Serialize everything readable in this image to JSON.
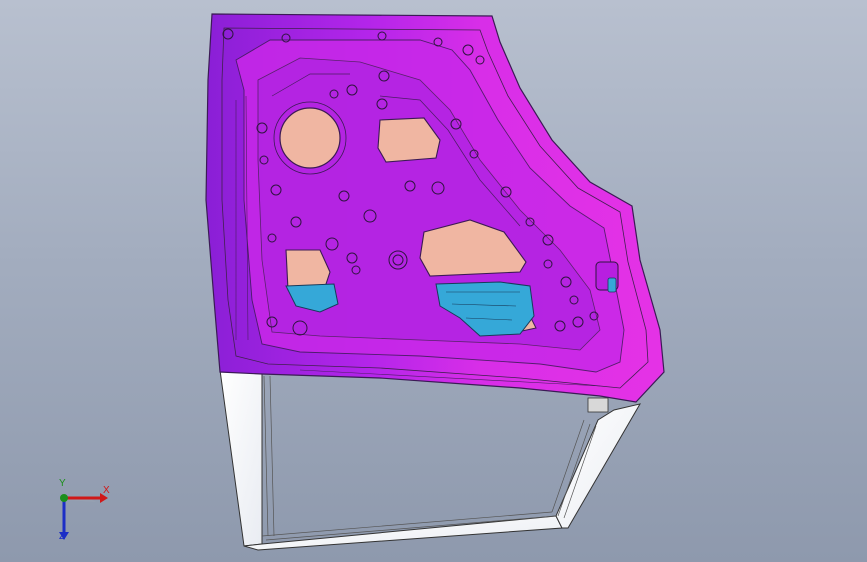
{
  "viewport": {
    "background_top": "#b8c0cf",
    "background_bottom": "#8e99ad"
  },
  "model": {
    "panel_color": "#d024e6",
    "panel_shade_color": "#9a1fd0",
    "edge_color": "#3b1a55",
    "opening_color": "#f0b8a0",
    "bracket_color": "#2fa7d8",
    "frame_color": "#ffffff"
  },
  "triad": {
    "x_label": "X",
    "y_label": "Y",
    "z_label": "Z",
    "x_color": "#d01818",
    "y_color": "#1c8f1c",
    "z_color": "#1c2ec6"
  }
}
